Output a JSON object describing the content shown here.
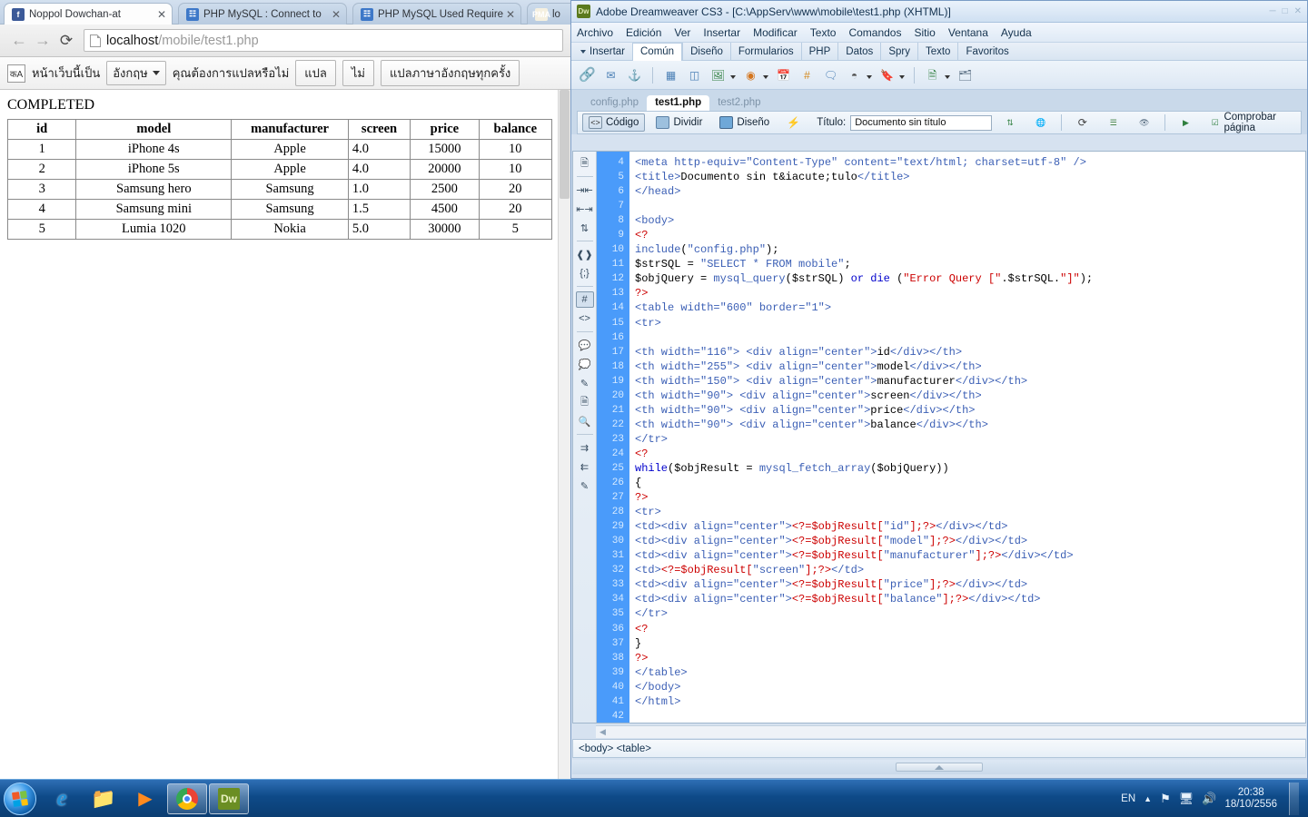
{
  "browser": {
    "tabs": [
      {
        "title": "Noppol Dowchan-at",
        "favicon": "facebook-icon",
        "favicon_text": "f",
        "active": true
      },
      {
        "title": "PHP MySQL : Connect to",
        "favicon": "document-icon",
        "favicon_text": "☷",
        "active": false
      },
      {
        "title": "PHP MySQL Used Require",
        "favicon": "document-icon",
        "favicon_text": "☷",
        "active": false
      },
      {
        "title": "lo",
        "favicon": "phpmyadmin-icon",
        "favicon_text": "PMA",
        "active": false
      }
    ],
    "nav": {
      "back_icon": "back-arrow-icon",
      "forward_icon": "forward-arrow-icon",
      "reload_icon": "reload-icon",
      "url_host": "localhost",
      "url_path": "/mobile/test1.php"
    },
    "translate_bar": {
      "icon": "translate-icon",
      "prefix_text": "หน้าเว็บนี้เป็น",
      "language": "อังกฤษ",
      "question": "คุณต้องการแปลหรือไม่",
      "translate_button": "แปล",
      "no_button": "ไม่",
      "always_button": "แปลภาษาอังกฤษทุกครั้ง"
    },
    "page": {
      "status_text": "COMPLETED",
      "table": {
        "headers": [
          "id",
          "model",
          "manufacturer",
          "screen",
          "price",
          "balance"
        ],
        "rows": [
          [
            "1",
            "iPhone 4s",
            "Apple",
            "4.0",
            "15000",
            "10"
          ],
          [
            "2",
            "iPhone 5s",
            "Apple",
            "4.0",
            "20000",
            "10"
          ],
          [
            "3",
            "Samsung hero",
            "Samsung",
            "1.0",
            "2500",
            "20"
          ],
          [
            "4",
            "Samsung mini",
            "Samsung",
            "1.5",
            "4500",
            "20"
          ],
          [
            "5",
            "Lumia 1020",
            "Nokia",
            "5.0",
            "30000",
            "5"
          ]
        ]
      }
    }
  },
  "dreamweaver": {
    "title": "Adobe Dreamweaver CS3 - [C:\\AppServ\\www\\mobile\\test1.php (XHTML)]",
    "logo_text": "Dw",
    "menus": [
      "Archivo",
      "Edición",
      "Ver",
      "Insertar",
      "Modificar",
      "Texto",
      "Comandos",
      "Sitio",
      "Ventana",
      "Ayuda"
    ],
    "insert_label": "Insertar",
    "insert_tabs": [
      {
        "label": "Común",
        "active": true
      },
      {
        "label": "Diseño",
        "active": false
      },
      {
        "label": "Formularios",
        "active": false
      },
      {
        "label": "PHP",
        "active": false
      },
      {
        "label": "Datos",
        "active": false
      },
      {
        "label": "Spry",
        "active": false
      },
      {
        "label": "Texto",
        "active": false
      },
      {
        "label": "Favoritos",
        "active": false
      }
    ],
    "insert_toolbar_icons": [
      "hyperlink-icon",
      "email-link-icon",
      "anchor-icon",
      "table-icon",
      "insert-div-icon",
      "image-icon",
      "media-icon",
      "date-icon",
      "server-side-include-icon",
      "comment-icon",
      "template-icon",
      "tag-chooser-icon",
      "script-icon",
      "head-icon"
    ],
    "file_tabs": [
      {
        "label": "config.php",
        "active": false
      },
      {
        "label": "test1.php",
        "active": true
      },
      {
        "label": "test2.php",
        "active": false
      }
    ],
    "doc_toolbar": {
      "code_button": "Código",
      "split_button": "Dividir",
      "design_button": "Diseño",
      "live_view_icon": "live-view-icon",
      "title_label": "Título:",
      "title_value": "Documento sin título",
      "file_management_icon": "file-management-icon",
      "preview_icon": "preview-in-browser-icon",
      "refresh_icon": "refresh-design-view-icon",
      "view_options_icon": "view-options-icon",
      "visual_aids_icon": "visual-aids-icon",
      "validate_icon": "validate-markup-icon",
      "check_page_icon": "check-page-icon",
      "check_page_label": "Comprobar página"
    },
    "coding_toolbar_icons": [
      "open-documents-icon",
      "collapse-full-tag-icon",
      "collapse-outside-selection-icon",
      "expand-all-icon",
      "select-parent-tag-icon",
      "balance-braces-icon",
      "line-numbers-icon",
      "highlight-invalid-code-icon",
      "apply-comment-icon",
      "remove-comment-icon",
      "wrap-tag-icon",
      "recent-snippets-icon",
      "move-to-source-icon",
      "indent-code-icon",
      "outdent-code-icon",
      "format-source-code-icon"
    ],
    "code": {
      "first_line": 4,
      "lines": [
        [
          {
            "t": "<meta http-equiv=",
            "c": "tag"
          },
          {
            "t": "\"Content-Type\"",
            "c": "str"
          },
          {
            "t": " content=",
            "c": "tag"
          },
          {
            "t": "\"text/html; charset=utf-8\"",
            "c": "str"
          },
          {
            "t": " />",
            "c": "tag"
          }
        ],
        [
          {
            "t": "<title>",
            "c": "tag"
          },
          {
            "t": "Documento sin t&iacute;tulo",
            "c": "plain"
          },
          {
            "t": "</title>",
            "c": "tag"
          }
        ],
        [
          {
            "t": "</head>",
            "c": "tag"
          }
        ],
        [],
        [
          {
            "t": "<body>",
            "c": "tag"
          }
        ],
        [
          {
            "t": "<?",
            "c": "red"
          }
        ],
        [
          {
            "t": "include",
            "c": "fn"
          },
          {
            "t": "(",
            "c": "plain"
          },
          {
            "t": "\"config.php\"",
            "c": "str"
          },
          {
            "t": ");",
            "c": "plain"
          }
        ],
        [
          {
            "t": "$strSQL = ",
            "c": "plain"
          },
          {
            "t": "\"SELECT * FROM mobile\"",
            "c": "str"
          },
          {
            "t": ";",
            "c": "plain"
          }
        ],
        [
          {
            "t": "$objQuery = ",
            "c": "plain"
          },
          {
            "t": "mysql_query",
            "c": "fn"
          },
          {
            "t": "($strSQL) ",
            "c": "plain"
          },
          {
            "t": "or die",
            "c": "kw"
          },
          {
            "t": " (",
            "c": "plain"
          },
          {
            "t": "\"Error Query [\"",
            "c": "red"
          },
          {
            "t": ".$strSQL.",
            "c": "plain"
          },
          {
            "t": "\"]\"",
            "c": "red"
          },
          {
            "t": ");",
            "c": "plain"
          }
        ],
        [
          {
            "t": "?>",
            "c": "red"
          }
        ],
        [
          {
            "t": "<table ",
            "c": "tag"
          },
          {
            "t": "width=",
            "c": "tag"
          },
          {
            "t": "\"600\"",
            "c": "str"
          },
          {
            "t": " border=",
            "c": "tag"
          },
          {
            "t": "\"1\"",
            "c": "str"
          },
          {
            "t": ">",
            "c": "tag"
          }
        ],
        [
          {
            "t": "<tr>",
            "c": "tag"
          }
        ],
        [],
        [
          {
            "t": "<th width=",
            "c": "tag"
          },
          {
            "t": "\"116\"",
            "c": "str"
          },
          {
            "t": "> <div align=",
            "c": "tag"
          },
          {
            "t": "\"center\"",
            "c": "str"
          },
          {
            "t": ">",
            "c": "tag"
          },
          {
            "t": "id",
            "c": "plain"
          },
          {
            "t": "</div></th>",
            "c": "tag"
          }
        ],
        [
          {
            "t": "<th width=",
            "c": "tag"
          },
          {
            "t": "\"255\"",
            "c": "str"
          },
          {
            "t": "> <div align=",
            "c": "tag"
          },
          {
            "t": "\"center\"",
            "c": "str"
          },
          {
            "t": ">",
            "c": "tag"
          },
          {
            "t": "model",
            "c": "plain"
          },
          {
            "t": "</div></th>",
            "c": "tag"
          }
        ],
        [
          {
            "t": "<th width=",
            "c": "tag"
          },
          {
            "t": "\"150\"",
            "c": "str"
          },
          {
            "t": "> <div align=",
            "c": "tag"
          },
          {
            "t": "\"center\"",
            "c": "str"
          },
          {
            "t": ">",
            "c": "tag"
          },
          {
            "t": "manufacturer",
            "c": "plain"
          },
          {
            "t": "</div></th>",
            "c": "tag"
          }
        ],
        [
          {
            "t": "<th width=",
            "c": "tag"
          },
          {
            "t": "\"90\"",
            "c": "str"
          },
          {
            "t": "> <div align=",
            "c": "tag"
          },
          {
            "t": "\"center\"",
            "c": "str"
          },
          {
            "t": ">",
            "c": "tag"
          },
          {
            "t": "screen",
            "c": "plain"
          },
          {
            "t": "</div></th>",
            "c": "tag"
          }
        ],
        [
          {
            "t": "<th width=",
            "c": "tag"
          },
          {
            "t": "\"90\"",
            "c": "str"
          },
          {
            "t": "> <div align=",
            "c": "tag"
          },
          {
            "t": "\"center\"",
            "c": "str"
          },
          {
            "t": ">",
            "c": "tag"
          },
          {
            "t": "price",
            "c": "plain"
          },
          {
            "t": "</div></th>",
            "c": "tag"
          }
        ],
        [
          {
            "t": "<th width=",
            "c": "tag"
          },
          {
            "t": "\"90\"",
            "c": "str"
          },
          {
            "t": "> <div align=",
            "c": "tag"
          },
          {
            "t": "\"center\"",
            "c": "str"
          },
          {
            "t": ">",
            "c": "tag"
          },
          {
            "t": "balance",
            "c": "plain"
          },
          {
            "t": "</div></th>",
            "c": "tag"
          }
        ],
        [
          {
            "t": "</tr>",
            "c": "tag"
          }
        ],
        [
          {
            "t": "<?",
            "c": "red"
          }
        ],
        [
          {
            "t": "while",
            "c": "kw"
          },
          {
            "t": "($objResult = ",
            "c": "plain"
          },
          {
            "t": "mysql_fetch_array",
            "c": "fn"
          },
          {
            "t": "($objQuery))",
            "c": "plain"
          }
        ],
        [
          {
            "t": "{",
            "c": "plain"
          }
        ],
        [
          {
            "t": "?>",
            "c": "red"
          }
        ],
        [
          {
            "t": "<tr>",
            "c": "tag"
          }
        ],
        [
          {
            "t": "<td><div align=",
            "c": "tag"
          },
          {
            "t": "\"center\"",
            "c": "str"
          },
          {
            "t": ">",
            "c": "tag"
          },
          {
            "t": "<?=$objResult[",
            "c": "red"
          },
          {
            "t": "\"id\"",
            "c": "str"
          },
          {
            "t": "];?>",
            "c": "red"
          },
          {
            "t": "</div></td>",
            "c": "tag"
          }
        ],
        [
          {
            "t": "<td><div align=",
            "c": "tag"
          },
          {
            "t": "\"center\"",
            "c": "str"
          },
          {
            "t": ">",
            "c": "tag"
          },
          {
            "t": "<?=$objResult[",
            "c": "red"
          },
          {
            "t": "\"model\"",
            "c": "str"
          },
          {
            "t": "];?>",
            "c": "red"
          },
          {
            "t": "</div></td>",
            "c": "tag"
          }
        ],
        [
          {
            "t": "<td><div align=",
            "c": "tag"
          },
          {
            "t": "\"center\"",
            "c": "str"
          },
          {
            "t": ">",
            "c": "tag"
          },
          {
            "t": "<?=$objResult[",
            "c": "red"
          },
          {
            "t": "\"manufacturer\"",
            "c": "str"
          },
          {
            "t": "];?>",
            "c": "red"
          },
          {
            "t": "</div></td>",
            "c": "tag"
          }
        ],
        [
          {
            "t": "<td>",
            "c": "tag"
          },
          {
            "t": "<?=$objResult[",
            "c": "red"
          },
          {
            "t": "\"screen\"",
            "c": "str"
          },
          {
            "t": "];?>",
            "c": "red"
          },
          {
            "t": "</td>",
            "c": "tag"
          }
        ],
        [
          {
            "t": "<td><div align=",
            "c": "tag"
          },
          {
            "t": "\"center\"",
            "c": "str"
          },
          {
            "t": ">",
            "c": "tag"
          },
          {
            "t": "<?=$objResult[",
            "c": "red"
          },
          {
            "t": "\"price\"",
            "c": "str"
          },
          {
            "t": "];?>",
            "c": "red"
          },
          {
            "t": "</div></td>",
            "c": "tag"
          }
        ],
        [
          {
            "t": "<td><div align=",
            "c": "tag"
          },
          {
            "t": "\"center\"",
            "c": "str"
          },
          {
            "t": ">",
            "c": "tag"
          },
          {
            "t": "<?=$objResult[",
            "c": "red"
          },
          {
            "t": "\"balance\"",
            "c": "str"
          },
          {
            "t": "];?>",
            "c": "red"
          },
          {
            "t": "</div></td>",
            "c": "tag"
          }
        ],
        [
          {
            "t": "</tr>",
            "c": "tag"
          }
        ],
        [
          {
            "t": "<?",
            "c": "red"
          }
        ],
        [
          {
            "t": "}",
            "c": "plain"
          }
        ],
        [
          {
            "t": "?>",
            "c": "red"
          }
        ],
        [
          {
            "t": "</table>",
            "c": "tag"
          }
        ],
        [
          {
            "t": "</body>",
            "c": "tag"
          }
        ],
        [
          {
            "t": "</html>",
            "c": "tag"
          }
        ],
        []
      ]
    },
    "status_bar": {
      "tag_selector": "<body> <table>"
    }
  },
  "taskbar": {
    "start_label": "start-orb",
    "items": [
      {
        "name": "internet-explorer",
        "open": false
      },
      {
        "name": "windows-explorer",
        "open": false
      },
      {
        "name": "windows-media-player",
        "open": false
      },
      {
        "name": "google-chrome",
        "open": true
      },
      {
        "name": "adobe-dreamweaver",
        "open": true,
        "label": "Dw"
      }
    ],
    "tray": {
      "language": "EN",
      "show_hidden_icon": "chevron-up-icon",
      "security_icon": "action-center-icon",
      "network_icon": "network-icon",
      "volume_icon": "volume-icon",
      "time": "20:38",
      "date": "18/10/2556"
    }
  },
  "colors": {
    "code_gutter": "#4a9bfa",
    "php_red": "#cc0000",
    "tag_blue": "#3b5fb5",
    "taskbar_blue": "#0e4a88"
  }
}
